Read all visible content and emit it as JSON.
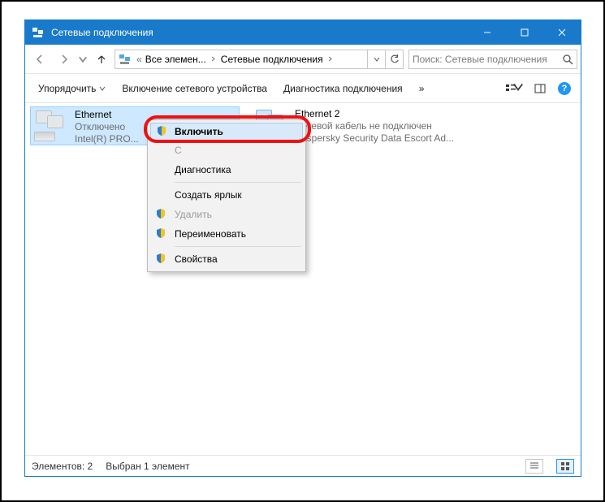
{
  "window": {
    "title": "Сетевые подключения"
  },
  "breadcrumb": {
    "prefix": "«",
    "part1": "Все элемен...",
    "part2": "Сетевые подключения"
  },
  "search": {
    "placeholder": "Поиск: Сетевые подключения"
  },
  "toolbar": {
    "organize": "Упорядочить",
    "enable_device": "Включение сетевого устройства",
    "diagnose": "Диагностика подключения",
    "overflow": "»"
  },
  "items": [
    {
      "name": "Ethernet",
      "status": "Отключено",
      "device": "Intel(R) PRO..."
    },
    {
      "name": "Ethernet 2",
      "status": "Сетевой кабель не подключен",
      "device": "Kaspersky Security Data Escort Ad..."
    }
  ],
  "context_menu": {
    "enable": "Включить",
    "status_item": "С",
    "diagnose": "Диагностика",
    "shortcut": "Создать ярлык",
    "delete": "Удалить",
    "rename": "Переименовать",
    "properties": "Свойства"
  },
  "statusbar": {
    "count": "Элементов: 2",
    "selected": "Выбран 1 элемент"
  }
}
